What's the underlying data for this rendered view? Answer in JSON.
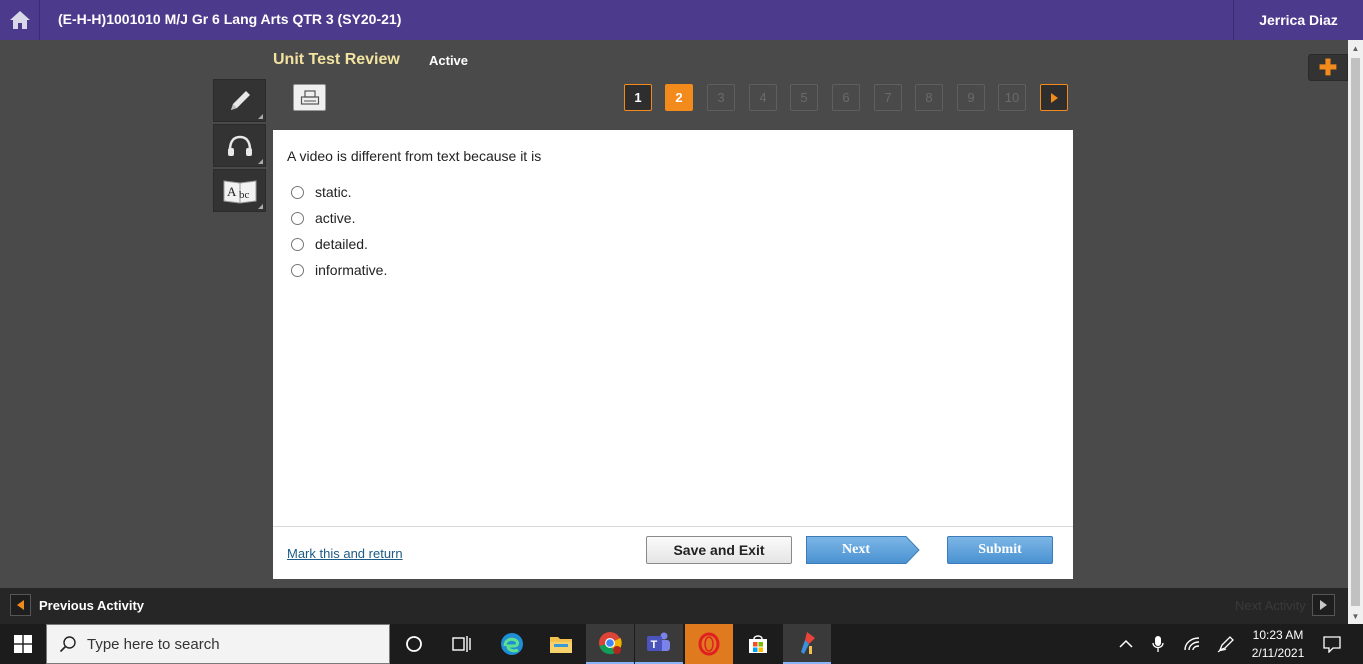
{
  "header": {
    "course_title": "(E-H-H)1001010 M/J Gr 6 Lang Arts QTR 3 (SY20-21)",
    "user_name": "Jerrica Diaz"
  },
  "test": {
    "title": "Unit Test Review",
    "status": "Active"
  },
  "tools": [
    {
      "name": "pencil-icon"
    },
    {
      "name": "headphones-icon"
    },
    {
      "name": "dictionary-icon"
    }
  ],
  "pagination": {
    "pages": [
      "1",
      "2",
      "3",
      "4",
      "5",
      "6",
      "7",
      "8",
      "9",
      "10"
    ],
    "current": 2,
    "visited": [
      1
    ]
  },
  "question": {
    "text": "A video is different from text because it is",
    "choices": [
      "static.",
      "active.",
      "detailed.",
      "informative."
    ]
  },
  "footer": {
    "mark_link": "Mark this and return",
    "save_exit_label": "Save and Exit",
    "next_label": "Next",
    "submit_label": "Submit"
  },
  "activity_bar": {
    "previous_label": "Previous Activity",
    "next_label": "Next Activity"
  },
  "taskbar": {
    "search_placeholder": "Type here to search",
    "time": "10:23 AM",
    "date": "2/11/2021"
  },
  "colors": {
    "header_purple": "#4c3a8c",
    "accent_orange": "#f28a1c",
    "button_blue": "#4a92d2",
    "link_blue": "#1b5b86",
    "title_yellow": "#f3e3a0"
  }
}
